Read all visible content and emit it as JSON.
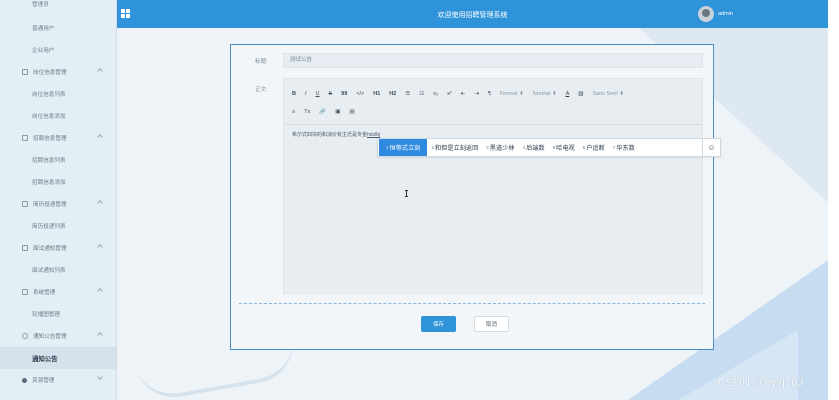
{
  "app": {
    "title": "欢迎使用招聘管理系统",
    "user": "admin"
  },
  "sidebar": {
    "items": [
      {
        "label": "管理员",
        "type": "sub"
      },
      {
        "label": "普通用户",
        "type": "sub"
      },
      {
        "label": "企业用户",
        "type": "sub"
      },
      {
        "label": "岗位信息管理",
        "type": "group",
        "icon": "folder-icon"
      },
      {
        "label": "岗位信息列表",
        "type": "sub"
      },
      {
        "label": "岗位信息添加",
        "type": "sub"
      },
      {
        "label": "招聘信息管理",
        "type": "group",
        "icon": "folder-icon"
      },
      {
        "label": "招聘信息列表",
        "type": "sub"
      },
      {
        "label": "招聘信息添加",
        "type": "sub"
      },
      {
        "label": "简历投递管理",
        "type": "group",
        "icon": "folder-icon"
      },
      {
        "label": "简历投递列表",
        "type": "sub"
      },
      {
        "label": "面试通知管理",
        "type": "group",
        "icon": "folder-icon"
      },
      {
        "label": "面试通知列表",
        "type": "sub"
      },
      {
        "label": "系统管理",
        "type": "group",
        "icon": "monitor-icon"
      },
      {
        "label": "轮播图管理",
        "type": "sub"
      },
      {
        "label": "通知公告管理",
        "type": "group",
        "icon": "info-icon"
      },
      {
        "label": "通知公告",
        "type": "active"
      },
      {
        "label": "资源管理",
        "type": "group",
        "icon": "location-icon"
      }
    ]
  },
  "form": {
    "title_label": "标题:",
    "title_value": "测试公告",
    "content_label": "正文:",
    "content_text": "希尔式四块的和消价有主迁是专金",
    "content_composing": "hdzlbj",
    "toolbar_row1": [
      {
        "t": "B",
        "cls": "b"
      },
      {
        "t": "I",
        "cls": "i"
      },
      {
        "t": "U",
        "cls": "u"
      },
      {
        "t": "S",
        "cls": "s"
      },
      {
        "t": "99",
        "cls": "b"
      },
      {
        "t": "</>",
        "cls": ""
      },
      {
        "t": "H1",
        "cls": "b"
      },
      {
        "t": "H2",
        "cls": "b"
      },
      {
        "t": "☰",
        "cls": ""
      },
      {
        "t": "☷",
        "cls": ""
      },
      {
        "t": "x₂",
        "cls": ""
      },
      {
        "t": "x²",
        "cls": ""
      },
      {
        "t": "⇤",
        "cls": ""
      },
      {
        "t": "⇥",
        "cls": ""
      },
      {
        "t": "¶",
        "cls": ""
      },
      {
        "t": "Normal ⬍",
        "cls": "sel"
      },
      {
        "t": "Normal ⬍",
        "cls": "sel"
      },
      {
        "t": "A",
        "cls": "ul"
      },
      {
        "t": "▧",
        "cls": ""
      },
      {
        "t": "Sans Serif ⬍",
        "cls": "sel"
      }
    ],
    "toolbar_row2": [
      {
        "t": "≡",
        "cls": ""
      },
      {
        "t": "Tx",
        "cls": ""
      },
      {
        "t": "🔗",
        "cls": ""
      },
      {
        "t": "▣",
        "cls": ""
      },
      {
        "t": "▤",
        "cls": ""
      }
    ],
    "save_label": "保存",
    "cancel_label": "取消"
  },
  "ime": {
    "candidates": [
      {
        "n": "1",
        "text": "恒等式立刻"
      },
      {
        "n": "2",
        "text": "和但是立刻返回"
      },
      {
        "n": "3",
        "text": "黑道少林"
      },
      {
        "n": "4",
        "text": "后端数"
      },
      {
        "n": "5",
        "text": "哈电视"
      },
      {
        "n": "6",
        "text": "户追断"
      },
      {
        "n": "7",
        "text": "华东数"
      }
    ],
    "emoji": "☺"
  },
  "watermark": "CSDN @bysj703",
  "colors": {
    "header": "#2e93d9",
    "sidebar": "#e4eef5",
    "accent": "#2e93d9"
  }
}
